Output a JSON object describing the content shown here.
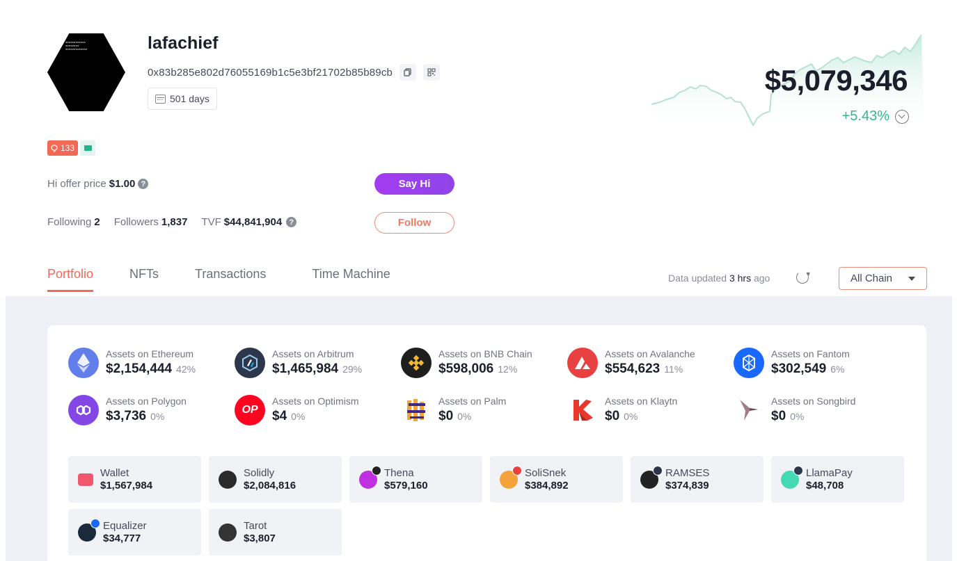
{
  "profile": {
    "username": "lafachief",
    "address": "0x83b285e802d76055169b1c5e3bf21702b85b89cb",
    "days": "501 days",
    "badge_count": "133",
    "offer_label": "Hi offer price",
    "offer_value": "$1.00",
    "following_label": "Following",
    "following_value": "2",
    "followers_label": "Followers",
    "followers_value": "1,837",
    "tvf_label": "TVF",
    "tvf_value": "$44,841,904",
    "say_hi_label": "Say Hi",
    "follow_label": "Follow",
    "net_worth": "$5,079,346",
    "change": "+5.43%"
  },
  "colors": {
    "accent": "#f26a55",
    "positive": "#33b888",
    "say_hi": "#9b3ff0"
  },
  "tabs": [
    "Portfolio",
    "NFTs",
    "Transactions",
    "Time Machine"
  ],
  "toolbar": {
    "updated_prefix": "Data updated",
    "updated_value": "3 hrs",
    "updated_suffix": "ago",
    "chain_select": "All Chain"
  },
  "chains": [
    {
      "label": "Assets on Ethereum",
      "value": "$2,154,444",
      "pct": "42%",
      "icon": "ethereum-icon",
      "color": "#627eea"
    },
    {
      "label": "Assets on Arbitrum",
      "value": "$1,465,984",
      "pct": "29%",
      "icon": "arbitrum-icon",
      "color": "#2d374b"
    },
    {
      "label": "Assets on BNB Chain",
      "value": "$598,006",
      "pct": "12%",
      "icon": "bnb-icon",
      "color": "#1e1e1e"
    },
    {
      "label": "Assets on Avalanche",
      "value": "$554,623",
      "pct": "11%",
      "icon": "avalanche-icon",
      "color": "#e84142"
    },
    {
      "label": "Assets on Fantom",
      "value": "$302,549",
      "pct": "6%",
      "icon": "fantom-icon",
      "color": "#1969ff"
    },
    {
      "label": "Assets on Polygon",
      "value": "$3,736",
      "pct": "0%",
      "icon": "polygon-icon",
      "color": "#8247e5"
    },
    {
      "label": "Assets on Optimism",
      "value": "$4",
      "pct": "0%",
      "icon": "optimism-icon",
      "color": "#ff0420",
      "text": "OP"
    },
    {
      "label": "Assets on Palm",
      "value": "$0",
      "pct": "0%",
      "icon": "palm-icon",
      "color": "#ffffff"
    },
    {
      "label": "Assets on Klaytn",
      "value": "$0",
      "pct": "0%",
      "icon": "klaytn-icon",
      "color": "#ffffff"
    },
    {
      "label": "Assets on Songbird",
      "value": "$0",
      "pct": "0%",
      "icon": "songbird-icon",
      "color": "#ffffff"
    }
  ],
  "protocols": [
    {
      "name": "Wallet",
      "value": "$1,567,984",
      "icon": "wallet-icon",
      "color": "#f0566c",
      "dot": ""
    },
    {
      "name": "Solidly",
      "value": "$2,084,816",
      "icon": "solidly-icon",
      "color": "#2a2a2a",
      "dot": ""
    },
    {
      "name": "Thena",
      "value": "$579,160",
      "icon": "thena-icon",
      "color": "#c02fe0",
      "dot": "#222222"
    },
    {
      "name": "SoliSnek",
      "value": "$384,892",
      "icon": "solisnek-icon",
      "color": "#f4a23a",
      "dot": "#e84142"
    },
    {
      "name": "RAMSES",
      "value": "$374,839",
      "icon": "ramses-icon",
      "color": "#222222",
      "dot": "#2d374b"
    },
    {
      "name": "LlamaPay",
      "value": "$48,708",
      "icon": "llamapay-icon",
      "color": "#43d9b3",
      "dot": "#2d374b"
    },
    {
      "name": "Equalizer",
      "value": "$34,777",
      "icon": "equalizer-icon",
      "color": "#1a2a3a",
      "dot": "#1969ff"
    },
    {
      "name": "Tarot",
      "value": "$3,807",
      "icon": "tarot-icon",
      "color": "#333333",
      "dot": ""
    }
  ]
}
